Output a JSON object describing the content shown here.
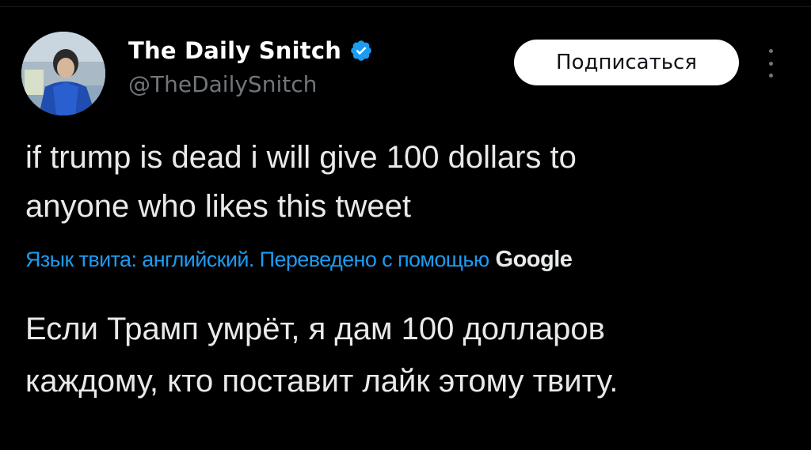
{
  "author": {
    "display_name": "The Daily Snitch",
    "handle": "@TheDailySnitch",
    "verified": true,
    "avatar_icon": "profile-photo"
  },
  "actions": {
    "follow_label": "Подписаться",
    "more_icon": "vertical-ellipsis-icon"
  },
  "tweet": {
    "lines": [
      "if trump is dead i will give 100 dollars to",
      "anyone who likes this tweet"
    ]
  },
  "translation": {
    "notice": "Язык твита: английский. Переведено с помощью",
    "provider": "Google",
    "lines": [
      "Если Трамп умрёт, я дам 100 долларов",
      "каждому, кто поставит лайк этому твиту."
    ]
  },
  "colors": {
    "background": "#000000",
    "text": "#e7e9ea",
    "secondary_text": "#71767b",
    "link": "#1d9bf0",
    "verified_badge": "#1d9bf0",
    "button_bg": "#ffffff",
    "button_text": "#0f1419"
  }
}
